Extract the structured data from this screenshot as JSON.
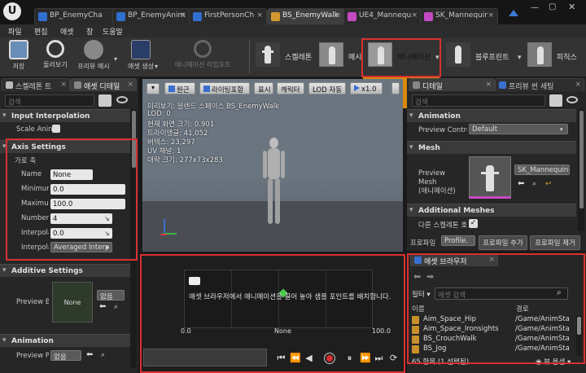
{
  "tabs": [
    {
      "label": "BP_EnemyCha",
      "color": "#2f6fd0"
    },
    {
      "label": "BP_EnemyAnim",
      "color": "#2f6fd0"
    },
    {
      "label": "FirstPersonCh",
      "color": "#2f6fd0"
    },
    {
      "label": "BS_EnemyWalk",
      "color": "#d49830"
    },
    {
      "label": "UE4_Mannequ",
      "color": "#c44ac4"
    },
    {
      "label": "SK_Mannequir",
      "color": "#c44ac4"
    }
  ],
  "menu": [
    "파일",
    "편집",
    "애셋",
    "창",
    "도움말"
  ],
  "toolbar": {
    "buttons": [
      "저장",
      "둘러보기",
      "프리뷰 메시",
      "애셋 생성",
      "애니메이션 리임포트"
    ],
    "modes": [
      "스켈레톤",
      "메시",
      "애니메이션",
      "블루프린트",
      "피직스"
    ]
  },
  "left_panel": {
    "tabs": [
      "스켈레톤 트",
      "애셋 디테일"
    ],
    "search_placeholder": "검색",
    "input_interpolation": {
      "header": "Input Interpolation",
      "scale_label": "Scale Anin"
    },
    "axis_settings": {
      "header": "Axis Settings",
      "subheader": "가로 축",
      "rows": [
        {
          "label": "Name",
          "value": "None"
        },
        {
          "label": "Minimum",
          "value": "0.0"
        },
        {
          "label": "Maximum",
          "value": "100.0"
        },
        {
          "label": "Number",
          "value": "4"
        },
        {
          "label": "Interpola",
          "value": "0.0"
        },
        {
          "label": "Interpola",
          "value": "Averaged Interp"
        }
      ]
    },
    "additive": {
      "header": "Additive Settings",
      "preview_label": "Preview Ba",
      "thumb_label": "None",
      "dropdown": "없음"
    },
    "animation": {
      "header": "Animation",
      "preview_label": "Preview P",
      "dropdown": "없음"
    }
  },
  "viewport": {
    "buttons": [
      "원근",
      "라이팅포함",
      "표시",
      "캐릭터",
      "LOD 자동",
      "x1.0"
    ],
    "info": [
      "미리보기: 블렌드 스페이스 BS_EnemyWalk",
      "LOD: 0",
      "현재 화면 크기: 0.901",
      "트라이앵글: 41,052",
      "버텍스: 23,297",
      "UV 채널: 1",
      "대략 크기: 277x73x283"
    ]
  },
  "blend_editor": {
    "hint": "애셋 브라우저에서 애니메이션을 끌어 놓아 샘플 포인트를 배치합니다.",
    "axis_min": "0.0",
    "axis_mid": "None",
    "axis_max": "100.0"
  },
  "right_panel": {
    "tabs": [
      "디테일",
      "프리뷰 씬 세팅"
    ],
    "search_placeholder": "검색",
    "animation": {
      "header": "Animation",
      "label": "Preview Contro",
      "value": "Default"
    },
    "mesh": {
      "header": "Mesh",
      "label": "Preview Mesh\n(애니메이션)",
      "value": "SK_Mannequin"
    },
    "additional": {
      "header": "Additional Meshes",
      "label": "다른 스켈레톤 호"
    },
    "profile": {
      "label": "프로파일",
      "dropdown": "Profile.",
      "add": "프로파일 추가",
      "remove": "프로파일 제거"
    }
  },
  "asset_browser": {
    "tab": "애셋 브라우저",
    "filter": "필터",
    "search_placeholder": "애셋 검색",
    "col_name": "이름",
    "col_path": "경로",
    "items": [
      {
        "name": "Aim_Space_Hip",
        "path": "/Game/AnimSta"
      },
      {
        "name": "Aim_Space_Ironsights",
        "path": "/Game/AnimSta"
      },
      {
        "name": "BS_CrouchWalk",
        "path": "/Game/AnimSta"
      },
      {
        "name": "BS_Jog",
        "path": "/Game/AnimSta"
      }
    ],
    "count": "65 항목 (1 선택됨)",
    "view_options": "뷰 옵션"
  }
}
